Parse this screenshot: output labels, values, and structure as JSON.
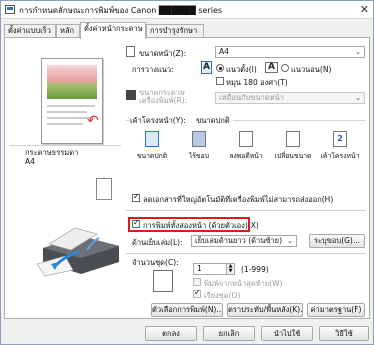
{
  "window": {
    "title": "การกำหนดลักษณะการพิมพ์ของ Canon ██████ series",
    "close_glyph": "✕"
  },
  "tabs": [
    {
      "label": "ตั้งค่าแบบเร็ว"
    },
    {
      "label": "หลัก"
    },
    {
      "label": "ตั้งค่าหน้ากระดาษ"
    },
    {
      "label": "การบำรุงรักษา"
    }
  ],
  "preview": {
    "media_label": "กระดาษธรรมดา",
    "media_size": "A4"
  },
  "page_setup": {
    "page_size_label": "ขนาดหน้า(Z):",
    "page_size_value": "A4",
    "orientation_label": "การวางแนว:",
    "portrait_label": "แนวตั้ง(I)",
    "landscape_label": "แนวนอน(N)",
    "rotate_label": "หมุน 180 องศา(T)",
    "printer_paper_label": "ขนาดกระดาษเครื่องพิมพ์(R):",
    "printer_paper_value": "เหมือนกับขนาดหน้า",
    "layout_label": "เค้าโครงหน้า(Y):",
    "layout_value_label": "ขนาดปกติ",
    "layouts": [
      {
        "label": "ขนาดปกติ",
        "icon": "normal-size-icon"
      },
      {
        "label": "ไร้ขอบ",
        "icon": "borderless-icon"
      },
      {
        "label": "ลงพอดีหน้า",
        "icon": "fit-to-page-icon"
      },
      {
        "label": "เปลี่ยนขนาด",
        "icon": "scaled-icon"
      },
      {
        "label": "เค้าโครงหน้า",
        "icon": "page-layout-icon",
        "badge": "2"
      }
    ],
    "auto_reduce_label": "ลดเอกสารที่ใหญ่อัตโนมัติที่เครื่องพิมพ์ไม่สามารถส่งออก(H)",
    "duplex_label": "การพิมพ์ทั้งสองหน้า (ด้วยตัวเอง)(X)",
    "stapling_label": "ด้านเย็บเล่ม(L):",
    "stapling_value": "เย็บเล่มด้านยาว (ด้านซ้าย)",
    "margin_button": "ระบุขอบ(G)...",
    "copies_label": "จำนวนชุด(C):",
    "copies_value": "1",
    "copies_range": "(1-999)",
    "last_page_first_label": "พิมพ์จากหน้าสุดท้าย(W)",
    "collate_label": "เรียงชุด(O)",
    "stamp_button": "ตัวเลือกการพิมพ์(N)...",
    "stamp_bg_button": "ตราประทับ/พื้นหลัง(K)...",
    "defaults_button": "ค่ามาตรฐาน(F)"
  },
  "footer": {
    "ok": "ตกลง",
    "cancel": "ยกเลิก",
    "apply": "นำไปใช้",
    "help": "วิธีใช้"
  }
}
